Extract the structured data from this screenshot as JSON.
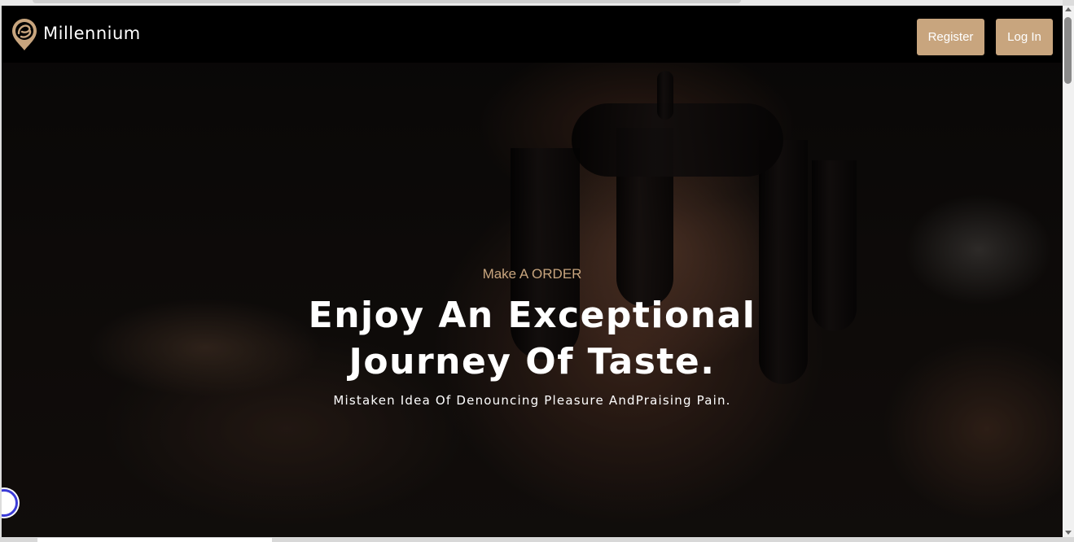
{
  "brand": {
    "name": "Millennium",
    "logo_icon": "millennium-logo-icon",
    "accent_color": "#c8a57e"
  },
  "nav": {
    "register_label": "Register",
    "login_label": "Log In"
  },
  "hero": {
    "eyebrow": "Make A ORDER",
    "title": "Enjoy An Exceptional Journey Of Taste.",
    "subtitle": "Mistaken Idea Of Denouncing Pleasure AndPraising Pain.",
    "background": "chocolate-brownie-photo"
  },
  "widgets": {
    "accessibility_icon": "accessibility-badge-icon"
  }
}
